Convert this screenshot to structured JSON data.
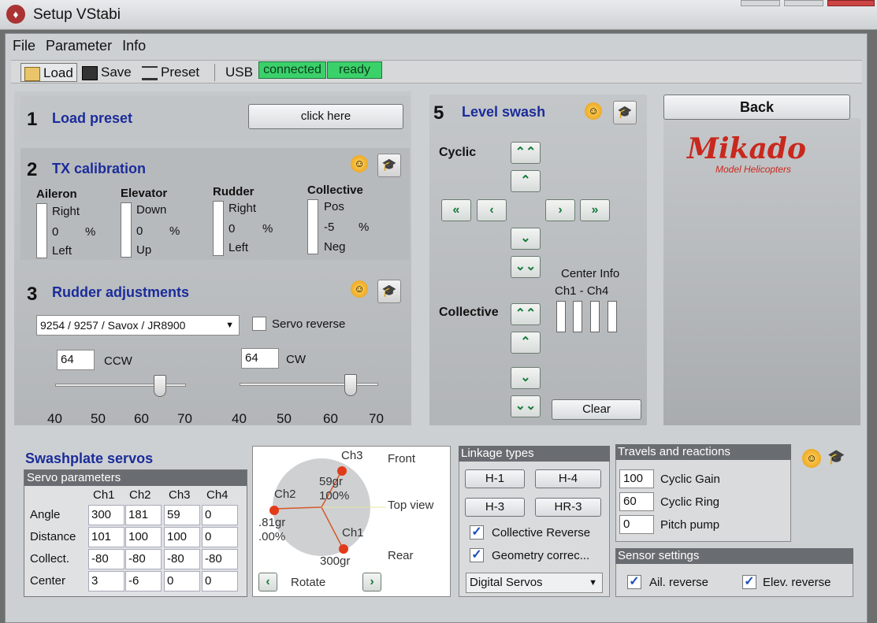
{
  "window": {
    "title": "Setup VStabi",
    "icon": "app-logo-icon"
  },
  "menu": [
    "File",
    "Parameter",
    "Info"
  ],
  "toolbar": {
    "load": "Load",
    "save": "Save",
    "preset": "Preset",
    "usb": "USB",
    "status_connected": "connected",
    "status_ready": "ready"
  },
  "sec1": {
    "num": "1",
    "title": "Load preset",
    "button": "click here"
  },
  "sec2": {
    "num": "2",
    "title": "TX calibration",
    "channels": [
      {
        "name": "Aileron",
        "top": "Right",
        "value": "0",
        "unit": "%",
        "bottom": "Left"
      },
      {
        "name": "Elevator",
        "top": "Down",
        "value": "0",
        "unit": "%",
        "bottom": "Up"
      },
      {
        "name": "Rudder",
        "top": "Right",
        "value": "0",
        "unit": "%",
        "bottom": "Left"
      },
      {
        "name": "Collective",
        "top": "Pos",
        "value": "-5",
        "unit": "%",
        "bottom": "Neg"
      }
    ]
  },
  "sec3": {
    "num": "3",
    "title": "Rudder adjustments",
    "servo_select": "9254 / 9257 / Savox / JR8900",
    "servo_reverse": "Servo reverse",
    "ccw": {
      "value": "64",
      "label": "CCW",
      "level": 64
    },
    "cw": {
      "value": "64",
      "label": "CW",
      "level": 64
    },
    "ticks": [
      "40",
      "50",
      "60",
      "70"
    ]
  },
  "sec5": {
    "num": "5",
    "title": "Level swash",
    "cyclic": "Cyclic",
    "collective": "Collective",
    "center_info": "Center Info",
    "center_ch": "Ch1  -  Ch4",
    "clear": "Clear"
  },
  "right": {
    "back": "Back",
    "logo": "Mikado",
    "logo_sub": "Model Helicopters"
  },
  "swash": {
    "title": "Swashplate servos",
    "params_header": "Servo parameters",
    "cols": [
      "Ch1",
      "Ch2",
      "Ch3",
      "Ch4"
    ],
    "rows": [
      {
        "label": "Angle",
        "vals": [
          "300",
          "181",
          "59",
          "0"
        ]
      },
      {
        "label": "Distance",
        "vals": [
          "101",
          "100",
          "100",
          "0"
        ]
      },
      {
        "label": "Collect.",
        "vals": [
          "-80",
          "-80",
          "-80",
          "-80"
        ]
      },
      {
        "label": "Center",
        "vals": [
          "3",
          "-6",
          "0",
          "0"
        ]
      }
    ]
  },
  "topview": {
    "front": "Front",
    "top_view": "Top view",
    "rear": "Rear",
    "rotate": "Rotate",
    "ch3": "Ch3",
    "ch2": "Ch2",
    "ch1": "Ch1",
    "ch3_val": "59gr",
    "ch3_pct": "100%",
    "ch2_val": ".81gr",
    "ch2_pct": ".00%",
    "ch1_val": "300gr"
  },
  "linkage": {
    "title": "Linkage types",
    "buttons": [
      "H-1",
      "H-4",
      "H-3",
      "HR-3"
    ],
    "collective_reverse": "Collective Reverse",
    "geometry": "Geometry correc...",
    "servo_type": "Digital Servos"
  },
  "travels": {
    "title": "Travels and reactions",
    "rows": [
      {
        "value": "100",
        "label": "Cyclic Gain"
      },
      {
        "value": "60",
        "label": "Cyclic Ring"
      },
      {
        "value": "0",
        "label": "Pitch pump"
      }
    ]
  },
  "sensor": {
    "title": "Sensor settings",
    "ail": "Ail. reverse",
    "elev": "Elev. reverse"
  },
  "colors": {
    "accent": "#1b2c9a",
    "status_green": "#3bd16a",
    "logo_red": "#c8281e"
  }
}
